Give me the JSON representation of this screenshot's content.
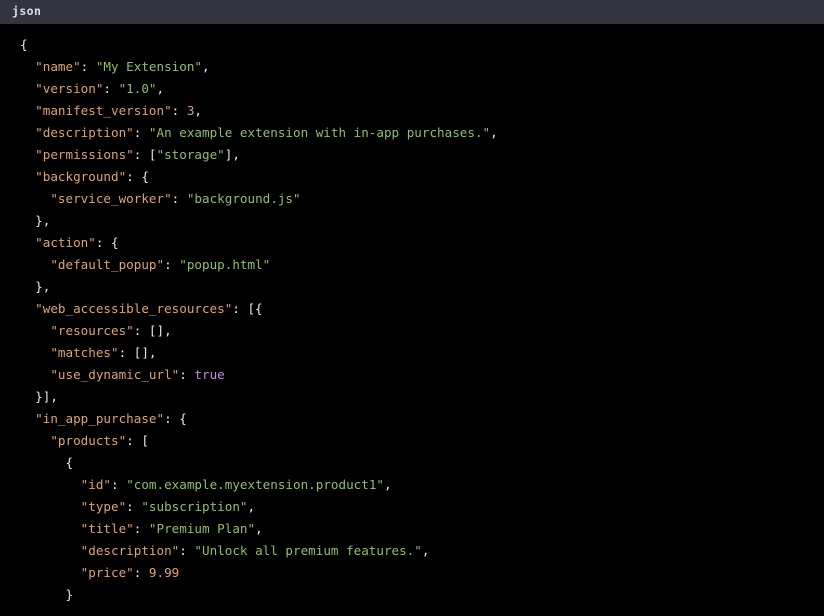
{
  "header": {
    "language_label": "json"
  },
  "theme": {
    "header_background": "#34343f",
    "header_text": "#dcdcec",
    "editor_background": "#000000",
    "punctuation": "#e9e9e9",
    "key": "#e0a271",
    "string": "#8fbf6b",
    "number": "#e0a271",
    "boolean": "#c08ae0"
  },
  "document": {
    "filetype": "json",
    "full_text": "{\n  \"name\": \"My Extension\",\n  \"version\": \"1.0\",\n  \"manifest_version\": 3,\n  \"description\": \"An example extension with in-app purchases.\",\n  \"permissions\": [\"storage\"],\n  \"background\": {\n    \"service_worker\": \"background.js\"\n  },\n  \"action\": {\n    \"default_popup\": \"popup.html\"\n  },\n  \"web_accessible_resources\": [{\n    \"resources\": [],\n    \"matches\": [],\n    \"use_dynamic_url\": true\n  }],\n  \"in_app_purchase\": {\n    \"products\": [\n      {\n        \"id\": \"com.example.myextension.product1\",\n        \"type\": \"subscription\",\n        \"title\": \"Premium Plan\",\n        \"description\": \"Unlock all premium features.\",\n        \"price\": 9.99\n      }",
    "lines": [
      {
        "indent": 0,
        "tokens": [
          {
            "t": "punc",
            "v": "{"
          }
        ]
      },
      {
        "indent": 1,
        "tokens": [
          {
            "t": "key",
            "v": "\"name\""
          },
          {
            "t": "punc",
            "v": ": "
          },
          {
            "t": "str",
            "v": "\"My Extension\""
          },
          {
            "t": "punc",
            "v": ","
          }
        ]
      },
      {
        "indent": 1,
        "tokens": [
          {
            "t": "key",
            "v": "\"version\""
          },
          {
            "t": "punc",
            "v": ": "
          },
          {
            "t": "str",
            "v": "\"1.0\""
          },
          {
            "t": "punc",
            "v": ","
          }
        ]
      },
      {
        "indent": 1,
        "tokens": [
          {
            "t": "key",
            "v": "\"manifest_version\""
          },
          {
            "t": "punc",
            "v": ": "
          },
          {
            "t": "num",
            "v": "3"
          },
          {
            "t": "punc",
            "v": ","
          }
        ]
      },
      {
        "indent": 1,
        "tokens": [
          {
            "t": "key",
            "v": "\"description\""
          },
          {
            "t": "punc",
            "v": ": "
          },
          {
            "t": "str",
            "v": "\"An example extension with in-app purchases.\""
          },
          {
            "t": "punc",
            "v": ","
          }
        ]
      },
      {
        "indent": 1,
        "tokens": [
          {
            "t": "key",
            "v": "\"permissions\""
          },
          {
            "t": "punc",
            "v": ": ["
          },
          {
            "t": "str",
            "v": "\"storage\""
          },
          {
            "t": "punc",
            "v": "],"
          }
        ]
      },
      {
        "indent": 1,
        "tokens": [
          {
            "t": "key",
            "v": "\"background\""
          },
          {
            "t": "punc",
            "v": ": {"
          }
        ]
      },
      {
        "indent": 2,
        "tokens": [
          {
            "t": "key",
            "v": "\"service_worker\""
          },
          {
            "t": "punc",
            "v": ": "
          },
          {
            "t": "str",
            "v": "\"background.js\""
          }
        ]
      },
      {
        "indent": 1,
        "tokens": [
          {
            "t": "punc",
            "v": "},"
          }
        ]
      },
      {
        "indent": 1,
        "tokens": [
          {
            "t": "key",
            "v": "\"action\""
          },
          {
            "t": "punc",
            "v": ": {"
          }
        ]
      },
      {
        "indent": 2,
        "tokens": [
          {
            "t": "key",
            "v": "\"default_popup\""
          },
          {
            "t": "punc",
            "v": ": "
          },
          {
            "t": "str",
            "v": "\"popup.html\""
          }
        ]
      },
      {
        "indent": 1,
        "tokens": [
          {
            "t": "punc",
            "v": "},"
          }
        ]
      },
      {
        "indent": 1,
        "tokens": [
          {
            "t": "key",
            "v": "\"web_accessible_resources\""
          },
          {
            "t": "punc",
            "v": ": [{"
          }
        ]
      },
      {
        "indent": 2,
        "tokens": [
          {
            "t": "key",
            "v": "\"resources\""
          },
          {
            "t": "punc",
            "v": ": [],"
          }
        ]
      },
      {
        "indent": 2,
        "tokens": [
          {
            "t": "key",
            "v": "\"matches\""
          },
          {
            "t": "punc",
            "v": ": [],"
          }
        ]
      },
      {
        "indent": 2,
        "tokens": [
          {
            "t": "key",
            "v": "\"use_dynamic_url\""
          },
          {
            "t": "punc",
            "v": ": "
          },
          {
            "t": "bool",
            "v": "true"
          }
        ]
      },
      {
        "indent": 1,
        "tokens": [
          {
            "t": "punc",
            "v": "}],"
          }
        ]
      },
      {
        "indent": 1,
        "tokens": [
          {
            "t": "key",
            "v": "\"in_app_purchase\""
          },
          {
            "t": "punc",
            "v": ": {"
          }
        ]
      },
      {
        "indent": 2,
        "tokens": [
          {
            "t": "key",
            "v": "\"products\""
          },
          {
            "t": "punc",
            "v": ": ["
          }
        ]
      },
      {
        "indent": 3,
        "tokens": [
          {
            "t": "punc",
            "v": "{"
          }
        ]
      },
      {
        "indent": 4,
        "tokens": [
          {
            "t": "key",
            "v": "\"id\""
          },
          {
            "t": "punc",
            "v": ": "
          },
          {
            "t": "str",
            "v": "\"com.example.myextension.product1\""
          },
          {
            "t": "punc",
            "v": ","
          }
        ]
      },
      {
        "indent": 4,
        "tokens": [
          {
            "t": "key",
            "v": "\"type\""
          },
          {
            "t": "punc",
            "v": ": "
          },
          {
            "t": "str",
            "v": "\"subscription\""
          },
          {
            "t": "punc",
            "v": ","
          }
        ]
      },
      {
        "indent": 4,
        "tokens": [
          {
            "t": "key",
            "v": "\"title\""
          },
          {
            "t": "punc",
            "v": ": "
          },
          {
            "t": "str",
            "v": "\"Premium Plan\""
          },
          {
            "t": "punc",
            "v": ","
          }
        ]
      },
      {
        "indent": 4,
        "tokens": [
          {
            "t": "key",
            "v": "\"description\""
          },
          {
            "t": "punc",
            "v": ": "
          },
          {
            "t": "str",
            "v": "\"Unlock all premium features.\""
          },
          {
            "t": "punc",
            "v": ","
          }
        ]
      },
      {
        "indent": 4,
        "tokens": [
          {
            "t": "key",
            "v": "\"price\""
          },
          {
            "t": "punc",
            "v": ": "
          },
          {
            "t": "num",
            "v": "9.99"
          }
        ]
      },
      {
        "indent": 3,
        "tokens": [
          {
            "t": "punc",
            "v": "}"
          }
        ]
      }
    ]
  }
}
